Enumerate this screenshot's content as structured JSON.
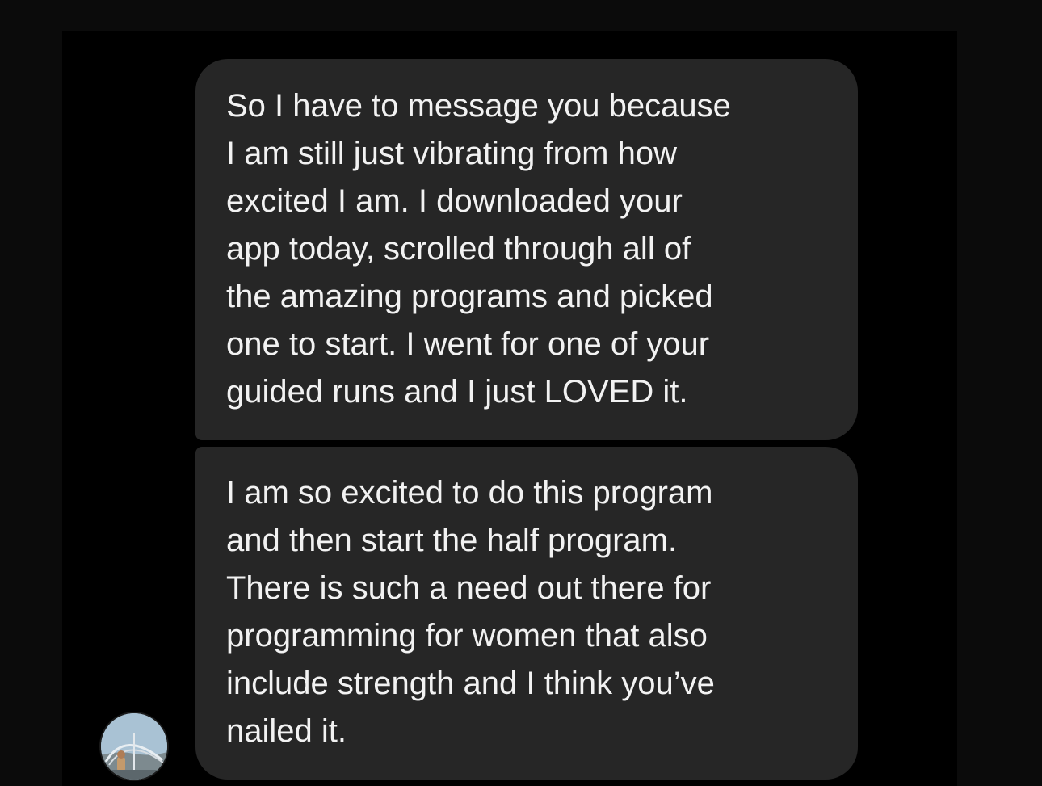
{
  "conversation": {
    "messages": [
      {
        "lines": [
          "So I have to message you because",
          "I am still just vibrating from how",
          "excited I am. I downloaded your",
          "app today, scrolled through all of",
          "the amazing programs and picked",
          "one to start. I went for one of your",
          "guided runs and I just LOVED it."
        ]
      },
      {
        "lines": [
          "I am so excited to do this program",
          "and then start the half program.",
          "There is such a need out there for",
          "programming for women that also",
          "include strength and I think you’ve",
          "nailed it."
        ]
      }
    ],
    "sender_avatar": {
      "icon": "profile-photo-icon"
    }
  },
  "colors": {
    "background": "#000000",
    "bubble": "#262626",
    "text": "#f2f2f2"
  }
}
